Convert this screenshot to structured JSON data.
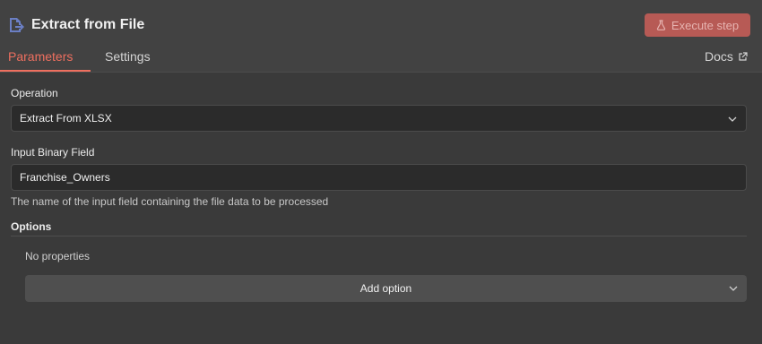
{
  "header": {
    "title": "Extract from File",
    "title_icon": "file-export-icon",
    "execute_label": "Execute step",
    "execute_icon": "flask-icon",
    "tabs": [
      {
        "label": "Parameters",
        "active": true
      },
      {
        "label": "Settings",
        "active": false
      }
    ],
    "docs_label": "Docs",
    "docs_icon": "external-link-icon"
  },
  "form": {
    "operation_label": "Operation",
    "operation_value": "Extract From XLSX",
    "binary_label": "Input Binary Field",
    "binary_value": "Franchise_Owners",
    "binary_hint": "The name of the input field containing the file data to be processed",
    "options_label": "Options",
    "no_properties": "No properties",
    "add_option_label": "Add option"
  },
  "colors": {
    "accent": "#ee6f5f",
    "execute_bg": "#b75a55",
    "background": "#3a3a3a",
    "header_bg": "#424242",
    "input_bg": "#2b2b2b"
  }
}
